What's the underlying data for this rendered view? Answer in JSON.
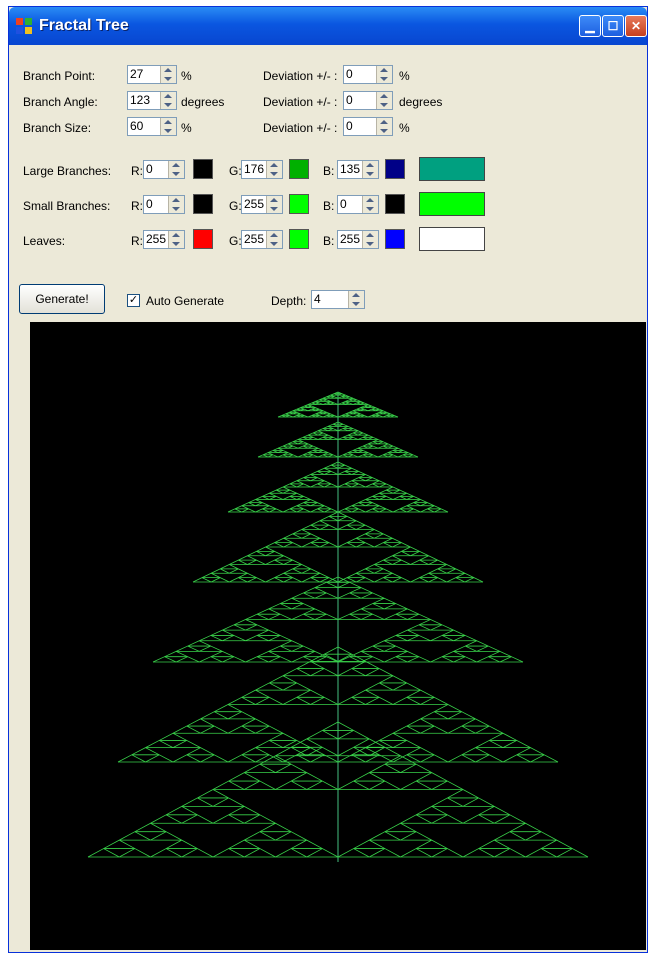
{
  "window": {
    "title": "Fractal Tree"
  },
  "params": {
    "branch_point": {
      "label": "Branch Point:",
      "value": "27",
      "unit": "%",
      "dev_label": "Deviation +/- :",
      "dev_value": "0",
      "dev_unit": "%"
    },
    "branch_angle": {
      "label": "Branch Angle:",
      "value": "123",
      "unit": "degrees",
      "dev_label": "Deviation +/- :",
      "dev_value": "0",
      "dev_unit": "degrees"
    },
    "branch_size": {
      "label": "Branch Size:",
      "value": "60",
      "unit": "%",
      "dev_label": "Deviation +/- :",
      "dev_value": "0",
      "dev_unit": "%"
    }
  },
  "colors": {
    "large": {
      "label": "Large Branches:",
      "r": "0",
      "g": "176",
      "b": "135",
      "mix": "#00b087"
    },
    "small": {
      "label": "Small Branches:",
      "r": "0",
      "g": "255",
      "b": "0",
      "mix": "#00ff00"
    },
    "leaves": {
      "label": "Leaves:",
      "r": "255",
      "g": "255",
      "b": "255",
      "mix": "#ffffff"
    },
    "r_label": "R:",
    "g_label": "G:",
    "b_label": "B:"
  },
  "actions": {
    "generate_label": "Generate!",
    "auto_generate_label": "Auto Generate",
    "auto_generate_checked": "✓",
    "depth_label": "Depth:",
    "depth_value": "4"
  }
}
